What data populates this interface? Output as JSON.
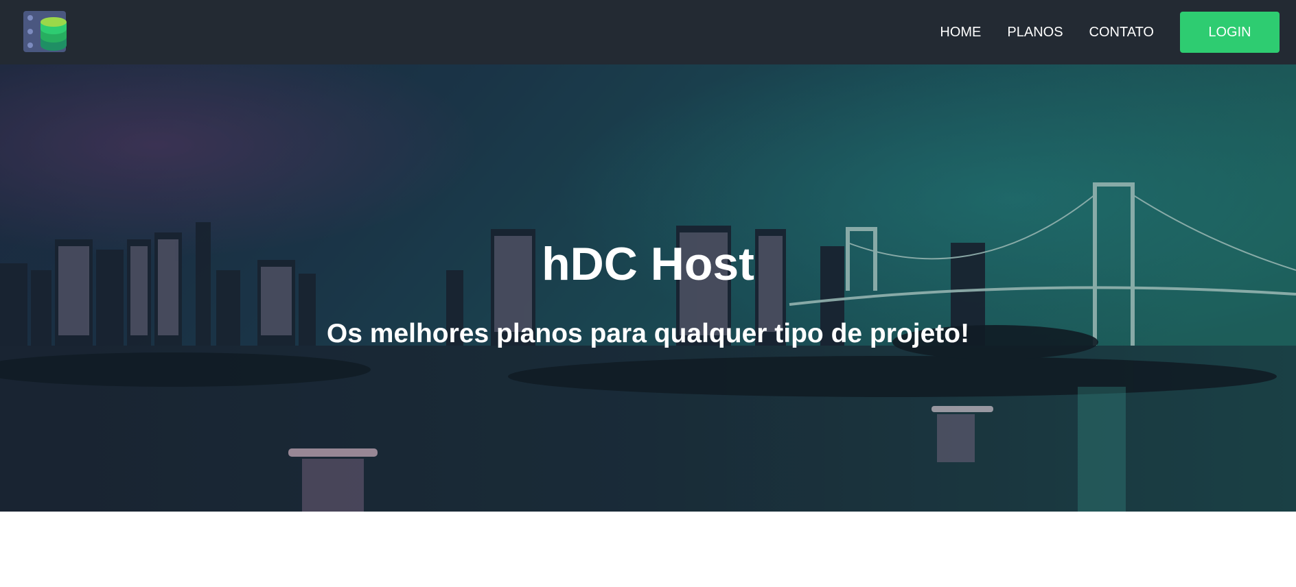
{
  "header": {
    "logo_icon": "database-server-icon",
    "nav": [
      {
        "label": "HOME"
      },
      {
        "label": "PLANOS"
      },
      {
        "label": "CONTATO"
      }
    ],
    "login_label": "LOGIN",
    "accent_color": "#2ecc71",
    "background_color": "#232a33"
  },
  "hero": {
    "title": "hDC Host",
    "subtitle": "Os melhores planos para qualquer tipo de projeto!",
    "background_image": "night-city-bridge-photo"
  }
}
